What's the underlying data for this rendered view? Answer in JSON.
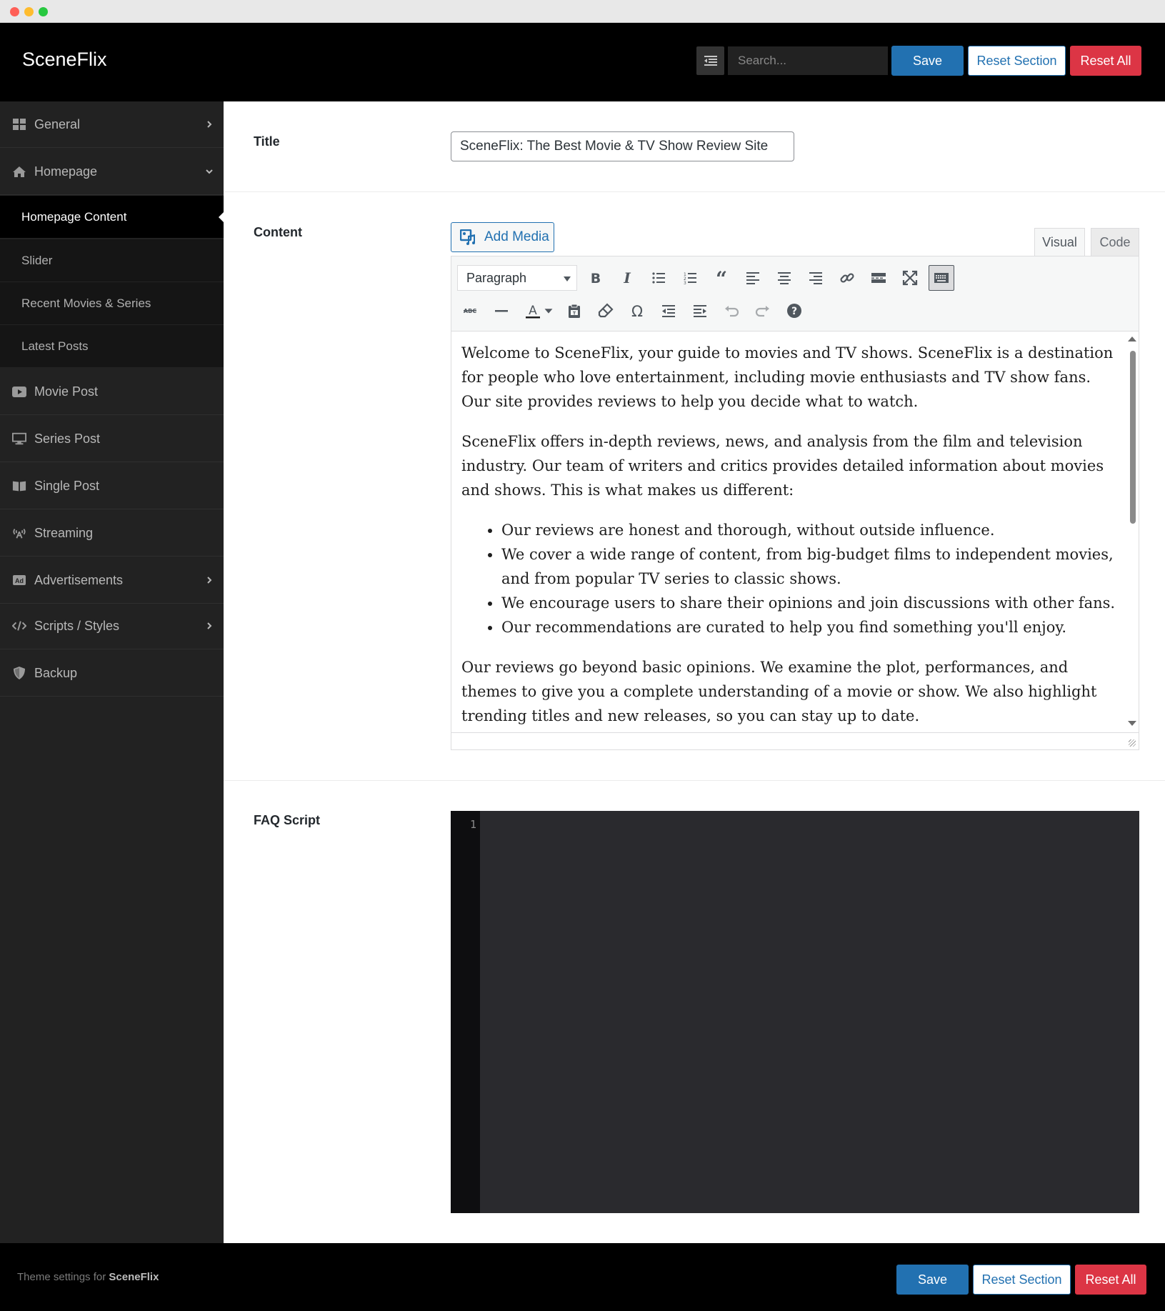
{
  "header": {
    "brand": "SceneFlix",
    "search_placeholder": "Search...",
    "save_label": "Save",
    "reset_section_label": "Reset Section",
    "reset_all_label": "Reset All"
  },
  "sidebar": {
    "items": [
      {
        "label": "General",
        "icon": "grid-icon",
        "chevron": "right"
      },
      {
        "label": "Homepage",
        "icon": "home-icon",
        "chevron": "down"
      },
      {
        "label": "Movie Post",
        "icon": "youtube-icon"
      },
      {
        "label": "Series Post",
        "icon": "monitor-icon"
      },
      {
        "label": "Single Post",
        "icon": "book-icon"
      },
      {
        "label": "Streaming",
        "icon": "broadcast-icon"
      },
      {
        "label": "Advertisements",
        "icon": "ad-icon",
        "chevron": "right"
      },
      {
        "label": "Scripts / Styles",
        "icon": "code-icon",
        "chevron": "right"
      },
      {
        "label": "Backup",
        "icon": "shield-icon"
      }
    ],
    "subitems": [
      {
        "label": "Homepage Content",
        "active": true
      },
      {
        "label": "Slider"
      },
      {
        "label": "Recent Movies & Series"
      },
      {
        "label": "Latest Posts"
      }
    ]
  },
  "fields": {
    "title_label": "Title",
    "title_value": "SceneFlix: The Best Movie & TV Show Review Site",
    "content_label": "Content",
    "add_media_label": "Add Media",
    "tab_visual": "Visual",
    "tab_code": "Code",
    "format_select": "Paragraph",
    "faq_label": "FAQ Script",
    "faq_line_number": "1"
  },
  "editor": {
    "p1": "Welcome to SceneFlix, your guide to movies and TV shows. SceneFlix is a destination for people who love entertainment, including movie enthusiasts and TV show fans. Our site provides reviews to help you decide what to watch.",
    "p2": "SceneFlix offers in-depth reviews, news, and analysis from the film and television industry. Our team of writers and critics provides detailed information about movies and shows. This is what makes us different:",
    "bullets": [
      "Our reviews are honest and thorough, without outside influence.",
      "We cover a wide range of content, from big-budget films to independent movies, and from popular TV series to classic shows.",
      "We encourage users to share their opinions and join discussions with other fans.",
      "Our recommendations are curated to help you find something you'll enjoy."
    ],
    "p3": "Our reviews go beyond basic opinions. We examine the plot, performances, and themes to give you a complete understanding of a movie or show. We also highlight trending titles and new releases, so you can stay up to date."
  },
  "footer": {
    "text_prefix": "Theme settings for",
    "brand": "SceneFlix",
    "save_label": "Save",
    "reset_section_label": "Reset Section",
    "reset_all_label": "Reset All"
  },
  "colors": {
    "primary": "#2271b1",
    "danger": "#dc3545",
    "sidebar_bg": "#222222",
    "header_bg": "#000000"
  }
}
